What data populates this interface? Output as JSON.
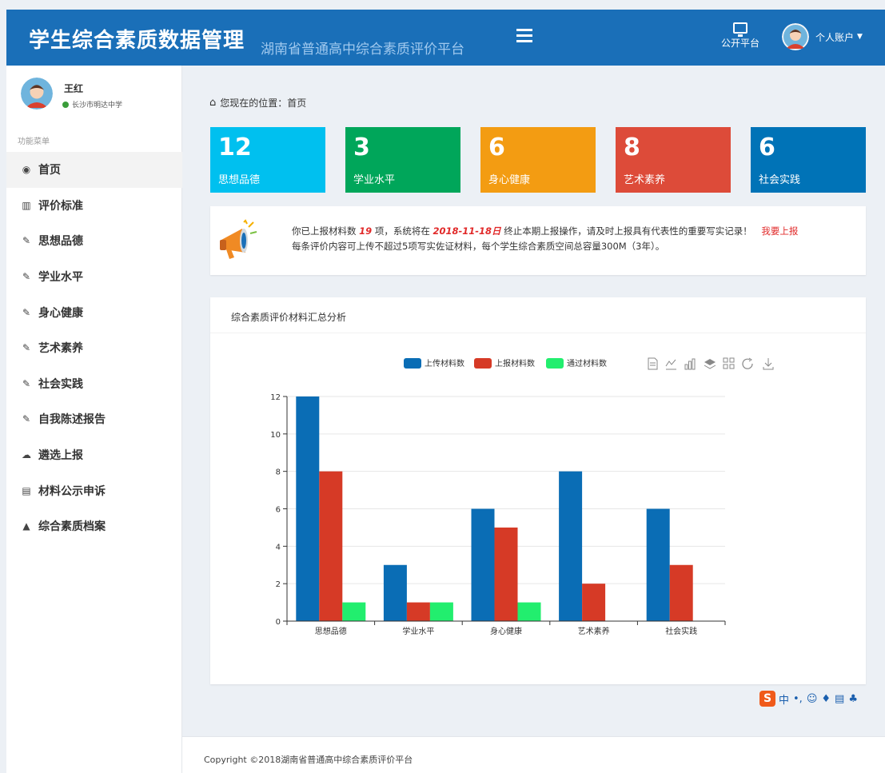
{
  "header": {
    "title": "学生综合素质数据管理",
    "subtitle": "湖南省普通高中综合素质评价平台",
    "public_platform": "公开平台",
    "account": "个人账户"
  },
  "sidebar": {
    "user_name": "王红",
    "school": "长沙市明达中学",
    "menu_header": "功能菜单",
    "items": [
      {
        "label": "首页",
        "icon": "dashboard-icon"
      },
      {
        "label": "评价标准",
        "icon": "map-icon"
      },
      {
        "label": "思想品德",
        "icon": "edit-icon"
      },
      {
        "label": "学业水平",
        "icon": "edit-icon"
      },
      {
        "label": "身心健康",
        "icon": "edit-icon"
      },
      {
        "label": "艺术素养",
        "icon": "edit-icon"
      },
      {
        "label": "社会实践",
        "icon": "edit-icon"
      },
      {
        "label": "自我陈述报告",
        "icon": "edit-icon"
      },
      {
        "label": "遴选上报",
        "icon": "cloud-upload-icon"
      },
      {
        "label": "材料公示申诉",
        "icon": "list-icon"
      },
      {
        "label": "综合素质档案",
        "icon": "graduation-cap-icon"
      }
    ]
  },
  "breadcrumb": {
    "prefix": "您现在的位置：",
    "current": "首页"
  },
  "stats": [
    {
      "value": "12",
      "label": "思想品德",
      "color": "#00c0ef"
    },
    {
      "value": "3",
      "label": "学业水平",
      "color": "#00a65a"
    },
    {
      "value": "6",
      "label": "身心健康",
      "color": "#f39c12"
    },
    {
      "value": "8",
      "label": "艺术素养",
      "color": "#dd4b39"
    },
    {
      "value": "6",
      "label": "社会实践",
      "color": "#0073b7"
    }
  ],
  "notice": {
    "l1_a": "你已上报材料数",
    "count": "19",
    "l1_b": "项，系统将在",
    "date": "2018-11-18日",
    "l1_c": "终止本期上报操作，请及时上报具有代表性的重要写实记录！",
    "action": "我要上报",
    "line2": "每条评价内容可上传不超过5项写实佐证材料，每个学生综合素质空间总容量300M（3年）。"
  },
  "chart_panel": {
    "title": "综合素质评价材料汇总分析"
  },
  "chart_data": {
    "type": "bar",
    "categories": [
      "思想品德",
      "学业水平",
      "身心健康",
      "艺术素养",
      "社会实践"
    ],
    "series": [
      {
        "name": "上传材料数",
        "values": [
          12,
          3,
          6,
          8,
          6
        ],
        "color": "#0a6db5"
      },
      {
        "name": "上报材料数",
        "values": [
          8,
          1,
          5,
          2,
          3
        ],
        "color": "#d63a26"
      },
      {
        "name": "通过材料数",
        "values": [
          1,
          1,
          1,
          0,
          0
        ],
        "color": "#22ee6e"
      }
    ],
    "ylim": [
      0,
      12
    ],
    "yticks": [
      0,
      2,
      4,
      6,
      8,
      10,
      12
    ],
    "grid": true,
    "legend": "top-center"
  },
  "ime": {
    "logo": "S",
    "lang": "中"
  },
  "footer": {
    "copyright": "Copyright ©2018湖南省普通高中综合素质评价平台"
  }
}
